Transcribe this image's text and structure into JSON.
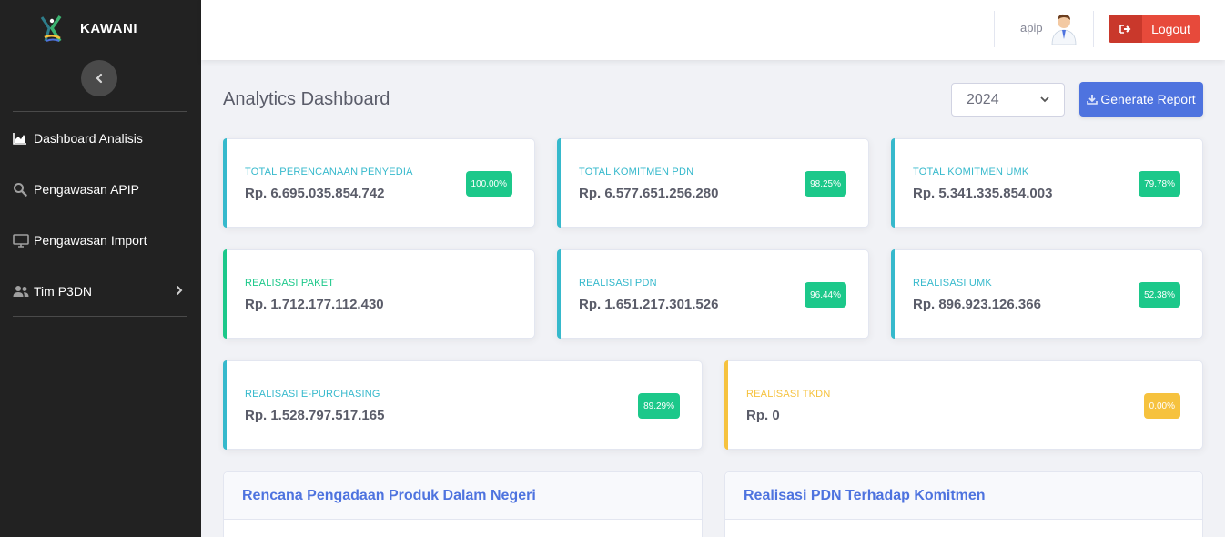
{
  "app": {
    "name": "KAWANI"
  },
  "sidebar": {
    "items": [
      {
        "label": "Dashboard Analisis",
        "icon": "area-chart-icon"
      },
      {
        "label": "Pengawasan APIP",
        "icon": "search-icon"
      },
      {
        "label": "Pengawasan Import",
        "icon": "monitor-icon"
      },
      {
        "label": "Tim P3DN",
        "icon": "users-icon"
      }
    ]
  },
  "topbar": {
    "username": "apip",
    "logout_label": "Logout"
  },
  "main": {
    "title": "Analytics Dashboard",
    "year": "2024",
    "generate_label": "Generate Report"
  },
  "cards": [
    {
      "label": "TOTAL PERENCANAAN PENYEDIA",
      "value": "Rp. 6.695.035.854.742",
      "badge": "100.00%"
    },
    {
      "label": "TOTAL KOMITMEN PDN",
      "value": "Rp. 6.577.651.256.280",
      "badge": "98.25%"
    },
    {
      "label": "TOTAL KOMITMEN UMK",
      "value": "Rp. 5.341.335.854.003",
      "badge": "79.78%"
    },
    {
      "label": "REALISASI PAKET",
      "value": "Rp. 1.712.177.112.430",
      "badge": ""
    },
    {
      "label": "REALISASI PDN",
      "value": "Rp. 1.651.217.301.526",
      "badge": "96.44%"
    },
    {
      "label": "REALISASI UMK",
      "value": "Rp. 896.923.126.366",
      "badge": "52.38%"
    },
    {
      "label": "REALISASI E-PURCHASING",
      "value": "Rp. 1.528.797.517.165",
      "badge": "89.29%"
    },
    {
      "label": "REALISASI TKDN",
      "value": "Rp. 0",
      "badge": "0.00%"
    }
  ],
  "panels": [
    {
      "title": "Rencana Pengadaan Produk Dalam Negeri"
    },
    {
      "title": "Realisasi PDN Terhadap Komitmen"
    }
  ],
  "colors": {
    "sidebar_bg": "#222222",
    "accent_info": "#36b9cc",
    "accent_success": "#1cc88a",
    "accent_warning": "#f6c23e",
    "badge_success": "#1cc88a",
    "badge_warning": "#f6c23e",
    "logout": "#e74a3b",
    "primary": "#4e73df"
  }
}
